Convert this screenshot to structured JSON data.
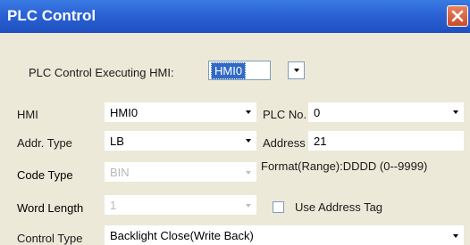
{
  "window": {
    "title": "PLC Control",
    "close_icon": "close-icon"
  },
  "exec_hmi": {
    "label": "PLC Control Executing HMI:",
    "value": "HMI0"
  },
  "hmi": {
    "label": "HMI",
    "value": "HMI0"
  },
  "plc_no": {
    "label": "PLC No.",
    "value": "0"
  },
  "addr_type": {
    "label": "Addr. Type",
    "value": "LB"
  },
  "address": {
    "label": "Address",
    "value": "21"
  },
  "code_type": {
    "label": "Code Type",
    "value": "BIN"
  },
  "format": {
    "text": "Format(Range):DDDD (0--9999)"
  },
  "word_length": {
    "label": "Word Length",
    "value": "1"
  },
  "use_address_tag": {
    "label": "Use Address Tag",
    "checked": false
  },
  "control_type": {
    "label": "Control Type",
    "value": "Backlight Close(Write Back)"
  },
  "colors": {
    "titlebar": "#2a62d4",
    "window_bg": "#ece9d8",
    "selection": "#316ac5"
  }
}
